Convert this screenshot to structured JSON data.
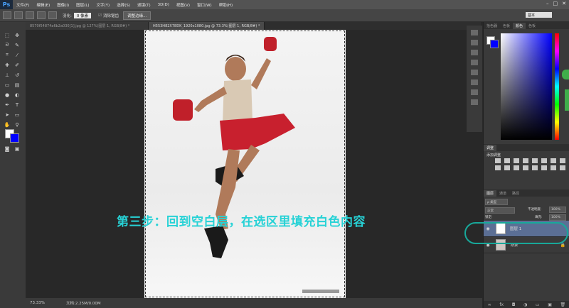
{
  "app": {
    "logo": "Ps"
  },
  "menu": [
    "文件(F)",
    "编辑(E)",
    "图像(I)",
    "图层(L)",
    "文字(Y)",
    "选择(S)",
    "滤镜(T)",
    "3D(D)",
    "视图(V)",
    "窗口(W)",
    "帮助(H)"
  ],
  "window_controls": {
    "minimize": "–",
    "restore": "□",
    "close": "✕"
  },
  "options": {
    "feather_label": "羽化:",
    "feather_value": "0 像素",
    "antialias_label": "消除锯齿",
    "refine_button": "调整边缘..."
  },
  "workspace": "基本",
  "tabs": [
    "8570f54874a6b2a030[1].jpg @ 127%(图层 1, RGB/8#) *",
    "H553H82X78DK_1920x1080.jpg @ 73.3%(图层 1, RGB/8#) *"
  ],
  "caption": "第三步：回到空白层，在选区里填充白色内容",
  "status": {
    "zoom": "73.33%",
    "doc": "文档:2.25M/0.00M"
  },
  "panels": {
    "color_tabs": [
      "拾色器",
      "色板",
      "颜色",
      "色板"
    ],
    "adjustments_title": "调整",
    "adjustments_subtitle": "添加调整",
    "layers_tabs": [
      "图层",
      "通道",
      "路径"
    ],
    "kind_label": "ρ 类型",
    "blend_mode": "正常",
    "opacity_label": "不透明度:",
    "opacity_value": "100%",
    "lock_label": "锁定:",
    "fill_label": "填充:",
    "fill_value": "100%",
    "layers": [
      {
        "name": "图层 1",
        "selected": true
      },
      {
        "name": "背景",
        "selected": false
      }
    ]
  },
  "colors": {
    "caption": "#27d2d6",
    "highlight": "#18a89a",
    "bg_swatch": "#0000ff",
    "fg_swatch": "#ffffff"
  }
}
